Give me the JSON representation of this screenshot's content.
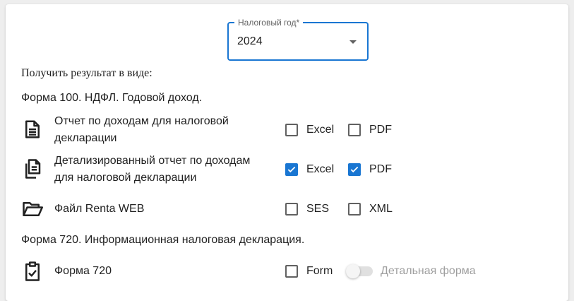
{
  "year_select": {
    "label": "Налоговый год*",
    "value": "2024"
  },
  "result_label": "Получить результат в виде:",
  "section_100": {
    "title": "Форма 100. НДФЛ. Годовой доход.",
    "rows": [
      {
        "icon": "document-icon",
        "label_line1": "Отчет по доходам для налоговой",
        "label_line2": "декларации",
        "options": [
          {
            "label": "Excel",
            "checked": false
          },
          {
            "label": "PDF",
            "checked": false
          }
        ]
      },
      {
        "icon": "documents-copy-icon",
        "label_line1": "Детализированный отчет по доходам",
        "label_line2": "для налоговой декларации",
        "options": [
          {
            "label": "Excel",
            "checked": true
          },
          {
            "label": "PDF",
            "checked": true
          }
        ]
      },
      {
        "icon": "folder-open-icon",
        "label_line1": "Файл Renta WEB",
        "options": [
          {
            "label": "SES",
            "checked": false
          },
          {
            "label": "XML",
            "checked": false
          }
        ]
      }
    ]
  },
  "section_720": {
    "title": "Форма 720. Информационная налоговая декларация.",
    "rows": [
      {
        "icon": "clipboard-check-icon",
        "label_line1": "Форма 720",
        "options": [
          {
            "label": "Form",
            "checked": false
          }
        ],
        "switch": {
          "label": "Детальная форма",
          "on": false,
          "disabled": true
        }
      }
    ]
  },
  "colors": {
    "accent": "#1976d2",
    "text": "#212121",
    "muted": "#9e9e9e"
  }
}
